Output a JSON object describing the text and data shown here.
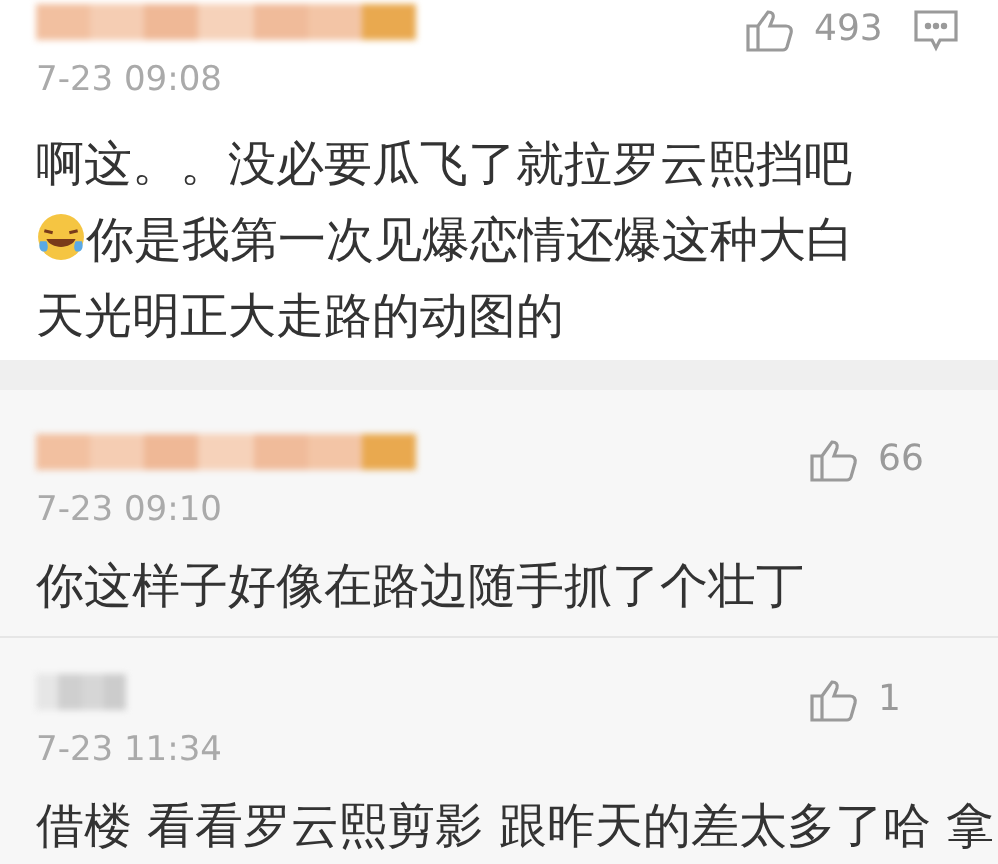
{
  "comments": [
    {
      "likes": "493",
      "show_reply_icon": true,
      "time": "7-23 09:08",
      "body": [
        {
          "kind": "text",
          "text": "啊这。。没必要瓜飞了就拉罗云熙挡吧"
        },
        {
          "kind": "emoji"
        },
        {
          "kind": "text",
          "text": "你是我第一次见爆恋情还爆这种大白天光明正大走路的动图的"
        }
      ]
    },
    {
      "likes": "66",
      "show_reply_icon": false,
      "time": "7-23 09:10",
      "body": [
        {
          "kind": "text",
          "text": "你这样子好像在路边随手抓了个壮丁"
        }
      ]
    },
    {
      "likes": "1",
      "show_reply_icon": false,
      "time": "7-23 11:34",
      "body": [
        {
          "kind": "text",
          "text": "借楼 看看罗云熙剪影 跟昨天的差太多了哈 拿"
        }
      ]
    }
  ]
}
